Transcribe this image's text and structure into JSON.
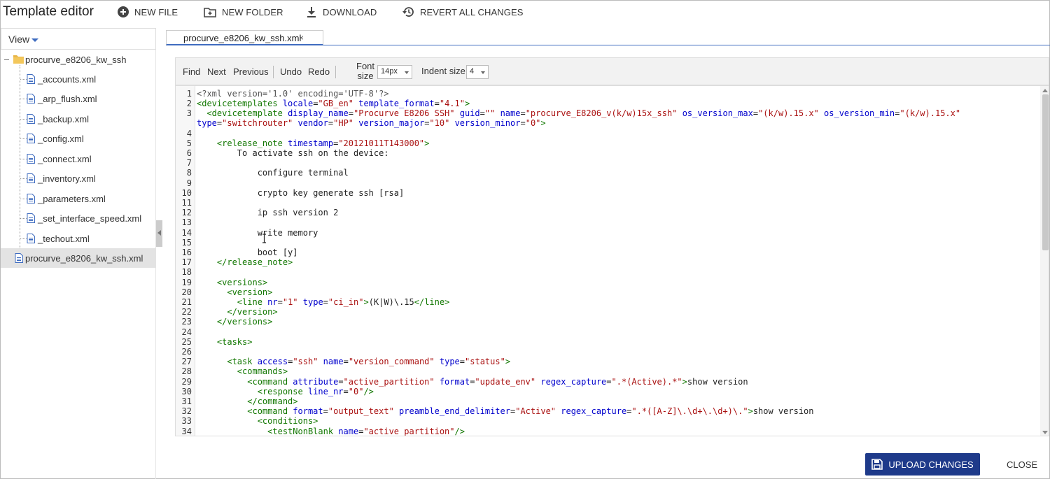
{
  "app_title": "Template editor",
  "toolbar": {
    "new_file": "NEW FILE",
    "new_folder": "NEW FOLDER",
    "download": "DOWNLOAD",
    "revert": "REVERT ALL CHANGES"
  },
  "sidebar": {
    "view_label": "View",
    "root_folder": "procurve_e8206_kw_ssh",
    "files": [
      "_accounts.xml",
      "_arp_flush.xml",
      "_backup.xml",
      "_config.xml",
      "_connect.xml",
      "_inventory.xml",
      "_parameters.xml",
      "_set_interface_speed.xml",
      "_techout.xml"
    ],
    "root_file": "procurve_e8206_kw_ssh.xml"
  },
  "tab": {
    "label": "procurve_e8206_kw_ssh.xml",
    "close": "×"
  },
  "editor_toolbar": {
    "find": "Find",
    "next": "Next",
    "previous": "Previous",
    "undo": "Undo",
    "redo": "Redo",
    "font_size_label_1": "Font",
    "font_size_label_2": "size",
    "font_size_value": "14px",
    "indent_size_label": "Indent size",
    "indent_size_value": "4"
  },
  "code": {
    "line_numbers": [
      "1",
      "2",
      "3",
      "4",
      "5",
      "6",
      "7",
      "8",
      "9",
      "10",
      "11",
      "12",
      "13",
      "14",
      "15",
      "16",
      "17",
      "18",
      "19",
      "20",
      "21",
      "22",
      "23",
      "24",
      "25",
      "26",
      "27",
      "28",
      "29",
      "30",
      "31",
      "32",
      "33",
      "34"
    ],
    "lines": {
      "l1": "<?xml version='1.0' encoding='UTF-8'?>",
      "l2_tag": "<devicetemplates",
      "l2_a1": "locale",
      "l2_v1": "\"GB_en\"",
      "l2_a2": "template_format",
      "l2_v2": "\"4.1\"",
      "l2_end": ">",
      "l3_tag": "  <devicetemplate",
      "l3_a1": "display_name",
      "l3_v1": "\"Procurve E8206 SSH\"",
      "l3_a2": "guid",
      "l3_v2": "\"\"",
      "l3_a3": "name",
      "l3_v3": "\"procurve_E8206_v(k/w)15x_ssh\"",
      "l3_a4": "os_version_max",
      "l3_v4": "\"(k/w).15.x\"",
      "l3_a5": "os_version_min",
      "l3_v5": "\"(k/w).15.x\"",
      "l3b_a1": "type",
      "l3b_v1": "\"switchrouter\"",
      "l3b_a2": "vendor",
      "l3b_v2": "\"HP\"",
      "l3b_a3": "version_major",
      "l3b_v3": "\"10\"",
      "l3b_a4": "version_minor",
      "l3b_v4": "\"0\"",
      "l3b_end": ">",
      "l5_tag": "    <release_note",
      "l5_a1": "timestamp",
      "l5_v1": "\"20121011T143000\"",
      "l5_end": ">",
      "l6": "        To activate ssh on the device:",
      "l8": "            configure terminal",
      "l10": "            crypto key generate ssh [rsa]",
      "l12": "            ip ssh version 2",
      "l14": "            write memory",
      "l16": "            boot [y]",
      "l17": "    </release_note>",
      "l19": "    <versions>",
      "l20": "      <version>",
      "l21_tag": "        <line",
      "l21_a1": "nr",
      "l21_v1": "\"1\"",
      "l21_a2": "type",
      "l21_v2": "\"ci_in\"",
      "l21_text": "(K|W)\\.15",
      "l21_close": "</line>",
      "l22": "      </version>",
      "l23": "    </versions>",
      "l25": "    <tasks>",
      "l27_tag": "      <task",
      "l27_a1": "access",
      "l27_v1": "\"ssh\"",
      "l27_a2": "name",
      "l27_v2": "\"version_command\"",
      "l27_a3": "type",
      "l27_v3": "\"status\"",
      "l27_end": ">",
      "l28": "        <commands>",
      "l29_tag": "          <command",
      "l29_a1": "attribute",
      "l29_v1": "\"active_partition\"",
      "l29_a2": "format",
      "l29_v2": "\"update_env\"",
      "l29_a3": "regex_capture",
      "l29_v3": "\".*(Active).*\"",
      "l29_text": "show version",
      "l30_tag": "            <response",
      "l30_a1": "line_nr",
      "l30_v1": "\"0\"",
      "l30_end": "/>",
      "l31": "          </command>",
      "l32_tag": "          <command",
      "l32_a1": "format",
      "l32_v1": "\"output_text\"",
      "l32_a2": "preamble_end_delimiter",
      "l32_v2": "\"Active\"",
      "l32_a3": "regex_capture",
      "l32_v3": "\".*([A-Z]\\.\\d+\\.\\d+)\\.\"",
      "l32_text": "show version",
      "l33": "            <conditions>",
      "l34_tag": "              <testNonBlank",
      "l34_a1": "name",
      "l34_v1": "\"active_partition\"",
      "l34_end": "/>"
    }
  },
  "footer": {
    "upload": "UPLOAD CHANGES",
    "close": "CLOSE"
  },
  "colors": {
    "accent": "#1e3a8a",
    "tag": "#117700",
    "attr": "#0000cc",
    "string": "#aa1111"
  }
}
